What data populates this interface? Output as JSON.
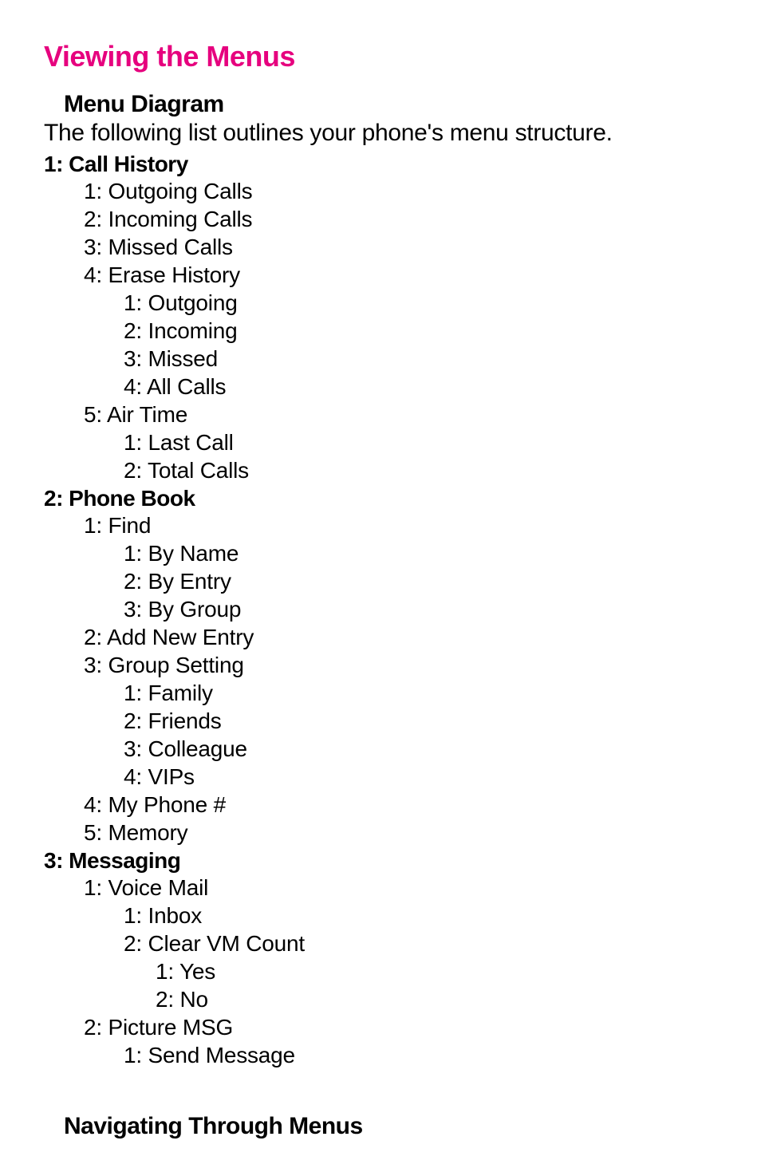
{
  "sectionTitle": "Viewing the Menus",
  "menuDiagramHeading": "Menu Diagram",
  "introText": "The following list outlines your phone's menu structure.",
  "menu": {
    "cat1": {
      "title": "1: Call History",
      "item1": "1: Outgoing Calls",
      "item2": "2: Incoming Calls",
      "item3": "3: Missed Calls",
      "item4": "4: Erase History",
      "item4_sub1": "1: Outgoing",
      "item4_sub2": "2: Incoming",
      "item4_sub3": "3: Missed",
      "item4_sub4": "4: All Calls",
      "item5": "5: Air Time",
      "item5_sub1": "1: Last Call",
      "item5_sub2": "2: Total Calls"
    },
    "cat2": {
      "title": "2: Phone Book",
      "item1": "1: Find",
      "item1_sub1": "1: By Name",
      "item1_sub2": "2: By Entry",
      "item1_sub3": "3: By Group",
      "item2": "2: Add New Entry",
      "item3": "3: Group Setting",
      "item3_sub1": "1: Family",
      "item3_sub2": "2: Friends",
      "item3_sub3": "3: Colleague",
      "item3_sub4": "4: VIPs",
      "item4": "4: My Phone #",
      "item5": "5: Memory"
    },
    "cat3": {
      "title": "3: Messaging",
      "item1": "1: Voice Mail",
      "item1_sub1": "1: Inbox",
      "item1_sub2": "2: Clear VM Count",
      "item1_sub2_sub1": "1: Yes",
      "item1_sub2_sub2": "2: No",
      "item2": "2: Picture MSG",
      "item2_sub1": "1: Send Message"
    }
  },
  "bottomHeading": "Navigating Through Menus"
}
